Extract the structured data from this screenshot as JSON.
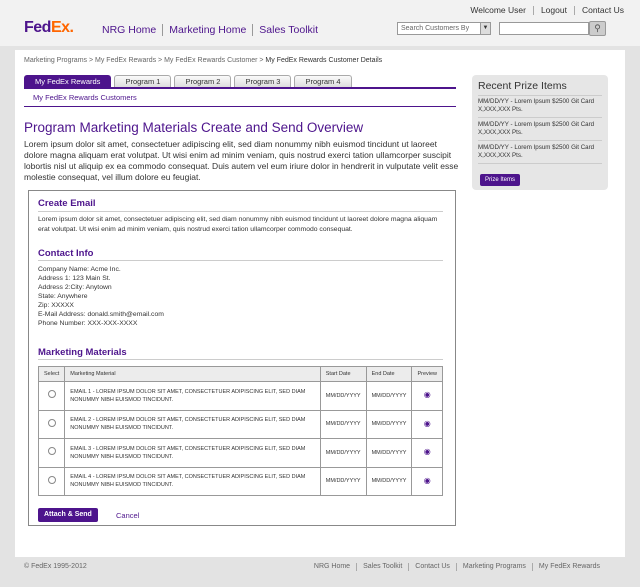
{
  "header": {
    "logo_fed": "Fed",
    "logo_ex": "Ex.",
    "main_nav": [
      "NRG Home",
      "Marketing Home",
      "Sales Toolkit"
    ],
    "util_nav": [
      "Welcome User",
      "Logout",
      "Contact Us"
    ],
    "search_select": "Search Customers By"
  },
  "breadcrumb": {
    "items": [
      "Marketing Programs",
      "My FedEx Rewards",
      "My FedEx Rewards Customer"
    ],
    "current": "My FedEx Rewards Customer Details"
  },
  "tabs": [
    "My FedEx Rewards",
    "Program 1",
    "Program 2",
    "Program 3",
    "Program 4"
  ],
  "subtab": "My FedEx Rewards Customers",
  "page": {
    "title": "Program Marketing Materials Create and Send Overview",
    "intro": "Lorem ipsum dolor sit amet, consectetuer adipiscing elit, sed diam nonummy nibh euismod tincidunt ut laoreet dolore magna aliquam erat volutpat. Ut wisi enim ad minim veniam, quis nostrud exerci tation ullamcorper suscipit lobortis nisl ut aliquip ex ea commodo consequat. Duis autem vel eum iriure dolor in hendrerit in vulputate velit esse molestie consequat, vel illum dolore eu feugiat."
  },
  "create_email": {
    "title": "Create Email",
    "text": "Lorem ipsum dolor sit amet, consectetuer adipiscing elit, sed diam nonummy nibh euismod tincidunt ut laoreet dolore magna aliquam erat volutpat. Ut wisi enim ad minim veniam, quis nostrud exerci tation ullamcorper commodo consequat."
  },
  "contact": {
    "title": "Contact Info",
    "lines": [
      "Company Name: Acme Inc.",
      "Address 1: 123 Main St.",
      "Address 2:City: Anytown",
      "State: Anywhere",
      "Zip: XXXXX",
      "E-Mail Address: donald.smith@email.com",
      "Phone Number: XXX-XXX-XXXX"
    ]
  },
  "materials": {
    "title": "Marketing Materials",
    "columns": [
      "Select",
      "Marketing Material",
      "Start Date",
      "End Date",
      "Preview"
    ],
    "rows": [
      {
        "material": "EMAIL 1 - LOREM IPSUM DOLOR SIT AMET, CONSECTETUER ADIPISCING ELIT, SED DIAM NONUMMY NIBH EUISMOD TINCIDUNT.",
        "start": "MM/DD/YYYY",
        "end": "MM/DD/YYYY"
      },
      {
        "material": "EMAIL 2 - LOREM IPSUM DOLOR SIT AMET, CONSECTETUER ADIPISCING ELIT, SED DIAM NONUMMY NIBH EUISMOD TINCIDUNT.",
        "start": "MM/DD/YYYY",
        "end": "MM/DD/YYYY"
      },
      {
        "material": "EMAIL 3 - LOREM IPSUM DOLOR SIT AMET, CONSECTETUER ADIPISCING ELIT, SED DIAM NONUMMY NIBH EUISMOD TINCIDUNT.",
        "start": "MM/DD/YYYY",
        "end": "MM/DD/YYYY"
      },
      {
        "material": "EMAIL 4 - LOREM IPSUM DOLOR SIT AMET, CONSECTETUER ADIPISCING ELIT, SED DIAM NONUMMY NIBH EUISMOD TINCIDUNT.",
        "start": "MM/DD/YYYY",
        "end": "MM/DD/YYYY"
      }
    ],
    "attach_label": "Attach & Send",
    "cancel_label": "Cancel"
  },
  "prizes": {
    "title": "Recent Prize Items",
    "items": [
      "MM/DD/YY - Lorem Ipsum $2500 Git Card X,XXX,XXX Pts.",
      "MM/DD/YY - Lorem Ipsum $2500 Git Card X,XXX,XXX Pts.",
      "MM/DD/YY - Lorem Ipsum $2500 Git Card X,XXX,XXX Pts."
    ],
    "button": "Prize Items"
  },
  "footer": {
    "copyright": "© FedEx 1995-2012",
    "links": [
      "NRG Home",
      "Sales Toolkit",
      "Contact Us",
      "Marketing Programs",
      "My FedEx Rewards"
    ]
  },
  "colors": {
    "brand_purple": "#4d148c",
    "brand_orange": "#ff6600"
  },
  "icons": {
    "search": "search-icon",
    "preview": "eye-icon",
    "dropdown": "chevron-down-icon"
  }
}
